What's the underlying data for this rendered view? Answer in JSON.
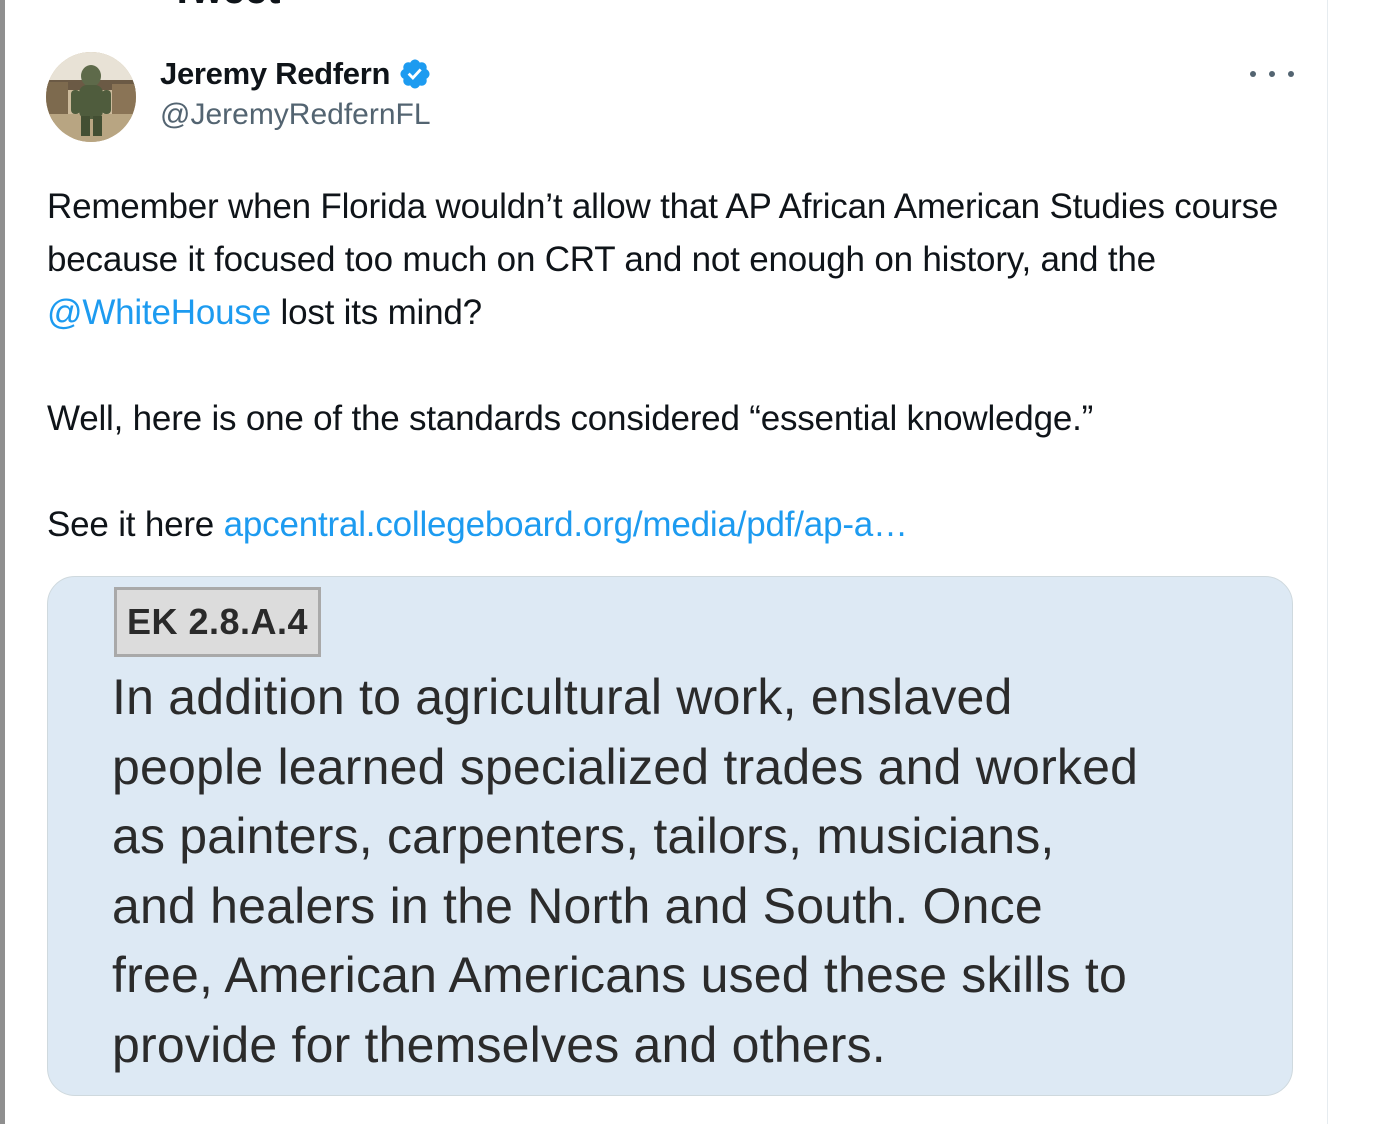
{
  "header": {
    "title": "Tweet"
  },
  "author": {
    "display_name": "Jeremy Redfern",
    "handle": "@JeremyRedfernFL",
    "verified": true,
    "avatar_icon": "avatar-photo",
    "more_icon": "more-options-icon"
  },
  "tweet": {
    "p1_before": "Remember when Florida wouldn’t allow that AP African American Studies course because it focused too much on CRT and not enough on history, and the ",
    "p1_mention": "@WhiteHouse",
    "p1_after": " lost its mind?",
    "p2": "Well, here is one of the standards considered “essential knowledge.”",
    "p3_before": "See it here ",
    "p3_link": "apcentral.collegeboard.org/media/pdf/ap-a…"
  },
  "media": {
    "tag": "EK 2.8.A.4",
    "lines": [
      "In addition to agricultural work, enslaved",
      "people learned specialized trades and worked",
      "as painters, carpenters, tailors, musicians,",
      "and healers in the North and South. Once",
      "free, American Americans used these skills to",
      "provide for themselves and others."
    ]
  },
  "colors": {
    "link": "#1d9bf0",
    "text": "#0f1419",
    "secondary": "#536471",
    "card_bg": "#dde9f4",
    "verified": "#1d9bf0"
  }
}
